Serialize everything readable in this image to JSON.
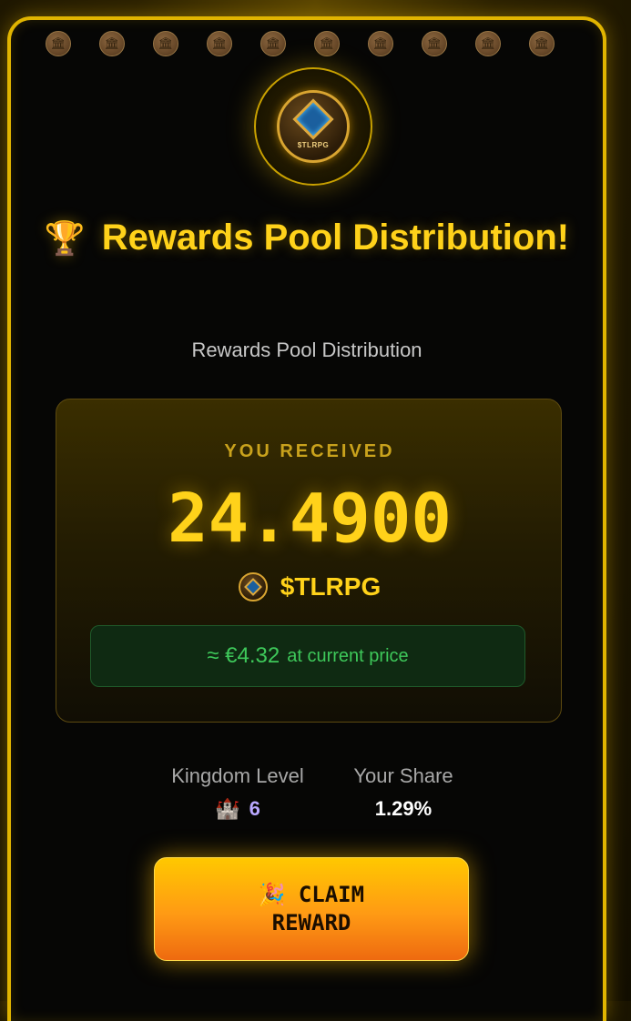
{
  "header": {
    "coin_icons": [
      "bank-icon",
      "bank-icon",
      "bank-icon",
      "bank-icon",
      "bank-icon",
      "bank-icon",
      "bank-icon",
      "bank-icon",
      "bank-icon",
      "bank-icon"
    ],
    "logo_text": "$TLRPG",
    "trophy_icon": "🏆",
    "title": "Rewards Pool Distribution!",
    "subtitle": "Rewards Pool Distribution"
  },
  "reward": {
    "label": "YOU RECEIVED",
    "amount": "24.4900",
    "token": "$TLRPG",
    "fiat_value": "≈ €4.32",
    "fiat_suffix": "at current price"
  },
  "stats": {
    "kingdom_label": "Kingdom Level",
    "kingdom_icon": "🏰",
    "kingdom_value": "6",
    "share_label": "Your Share",
    "share_value": "1.29%"
  },
  "button": {
    "icon": "🎉",
    "label": "CLAIM REWARD"
  },
  "colors": {
    "accent": "#ffd21a",
    "border": "#e0b400",
    "positive": "#3ec85a",
    "level": "#b9a8ff"
  }
}
